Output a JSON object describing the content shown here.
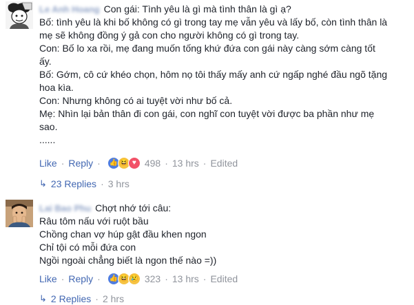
{
  "comment1": {
    "author": "Le Anh Hoang",
    "lines": [
      "Con gái: Tình yêu là gì mà tình thân là gì ạ?",
      "Bố: tình yêu là khi bố không có gì trong tay mẹ vẫn yêu và lấy bố, còn tình thân là",
      "mẹ sẽ không đồng ý gả con cho người không có gì trong tay.",
      "Con: Bố lo xa rồi, mẹ đang muốn tống khứ đứa con gái này càng sớm càng tốt",
      "ấy.",
      "Bố: Gớm, cô cứ khéo chọn, hôm nọ tôi thấy mấy anh cứ ngấp nghé đầu ngõ tặng",
      "hoa kìa.",
      "Con: Nhưng không có ai tuyệt vời như bố cả.",
      "Mẹ: Nhìn lại bản thân đi con gái, con nghĩ con tuyệt vời được ba phần như mẹ",
      "sao.",
      "......"
    ],
    "like_label": "Like",
    "reply_label": "Reply",
    "reaction_count": "498",
    "time": "13 hrs",
    "edited": "Edited",
    "replies_label": "23 Replies",
    "replies_time": "3 hrs"
  },
  "comment2": {
    "author": "Lai Bao Phu",
    "lines": [
      "Chợt nhớ tới câu:",
      "Râu tôm nấu với ruột bầu",
      "Chồng chan vợ húp gật đầu khen ngon",
      "Chỉ tội có mỗi đứa con",
      "Ngồi ngoài chẳng biết là ngon thế nào =))"
    ],
    "like_label": "Like",
    "reply_label": "Reply",
    "reaction_count": "323",
    "time": "13 hrs",
    "edited": "Edited",
    "replies_label": "2 Replies",
    "replies_time": "2 hrs"
  },
  "separator": "·",
  "icons": {
    "reply_arrow": "reply-arrow-icon",
    "reactions": [
      "like-icon",
      "haha-icon",
      "heart-icon",
      "sad-icon"
    ]
  },
  "colors": {
    "link": "#4267b2",
    "meta": "#90949c",
    "name": "#365899"
  }
}
